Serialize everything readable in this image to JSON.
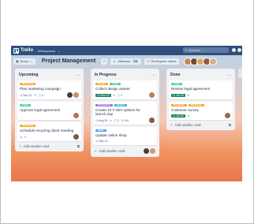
{
  "topbar": {
    "app_name": "Trello",
    "workspaces_label": "Workspaces",
    "workspaces_chevron": "⌄",
    "search_placeholder": "Jump to...",
    "search_icon": "⌕"
  },
  "board": {
    "view_button": "Board",
    "view_icon": "▦",
    "view_chevron": "⌄",
    "title": "Project Management",
    "star_icon": "☆",
    "integrations_label": "Atlassian",
    "integrations_count": "23",
    "workspace_visible_label": "Workspace visible",
    "workspace_visible_icon": "⚇"
  },
  "colors": {
    "green": "#4bce97",
    "orange": "#f5a623",
    "purple": "#9f6fe0",
    "blue": "#579dff",
    "teal": "#2ab7d9",
    "topbar": "#2f4f7a"
  },
  "lists": [
    {
      "title": "Upcoming",
      "menu": "…",
      "cards": [
        {
          "labels": [
            {
              "text": "Marketing",
              "color": "#f5a623"
            }
          ],
          "title": "Plan marketing campaign",
          "badges": [
            "◷ Sep 22",
            "≡",
            "▢ 2"
          ],
          "due": ""
        },
        {
          "labels": [
            {
              "text": "Legal",
              "color": "#4bce97"
            }
          ],
          "title": "Approve legal agreement",
          "badges": [],
          "due": ""
        },
        {
          "labels": [
            {
              "text": "Marketing",
              "color": "#f5a623"
            }
          ],
          "title": "Schedule recurring client meeting",
          "badges": [
            "◷",
            "≡"
          ],
          "due": ""
        }
      ],
      "add_label": "Add another card"
    },
    {
      "title": "In Progress",
      "menu": "…",
      "cards": [
        {
          "labels": [
            {
              "text": "Design",
              "color": "#f5a623"
            },
            {
              "text": "Legal",
              "color": "#4bce97"
            }
          ],
          "title": "Collect design assets",
          "badges": [
            "≡",
            "▢ 1"
          ],
          "due": "◷ Nov 13"
        },
        {
          "labels": [
            {
              "text": "Production",
              "color": "#9f6fe0"
            },
            {
              "text": "Design",
              "color": "#2ab7d9"
            }
          ],
          "title": "Create 10 T-shirt options for launch day",
          "badges": [
            "◷ Aug 26",
            "≡",
            "▢ 2",
            "☑ 0/4"
          ],
          "due": ""
        },
        {
          "labels": [
            {
              "text": "Sales",
              "color": "#579dff"
            }
          ],
          "title": "Update online shop",
          "badges": [
            "◷ Sep 10"
          ],
          "due": ""
        }
      ],
      "add_label": "Add another card"
    },
    {
      "title": "Done",
      "menu": "…",
      "cards": [
        {
          "labels": [
            {
              "text": "Legal",
              "color": "#4bce97"
            }
          ],
          "title": "Review legal agreement",
          "badges": [
            "≡"
          ],
          "due": "◷ Jul 18"
        },
        {
          "labels": [
            {
              "text": "Research",
              "color": "#f5a623"
            },
            {
              "text": "Marketing",
              "color": "#f5a623"
            }
          ],
          "title": "Customer survey",
          "badges": [
            "≡"
          ],
          "due": "◷ Jul 20"
        }
      ],
      "add_label": "Add another card"
    }
  ],
  "icons": {
    "plus": "+",
    "template": "⧉"
  }
}
